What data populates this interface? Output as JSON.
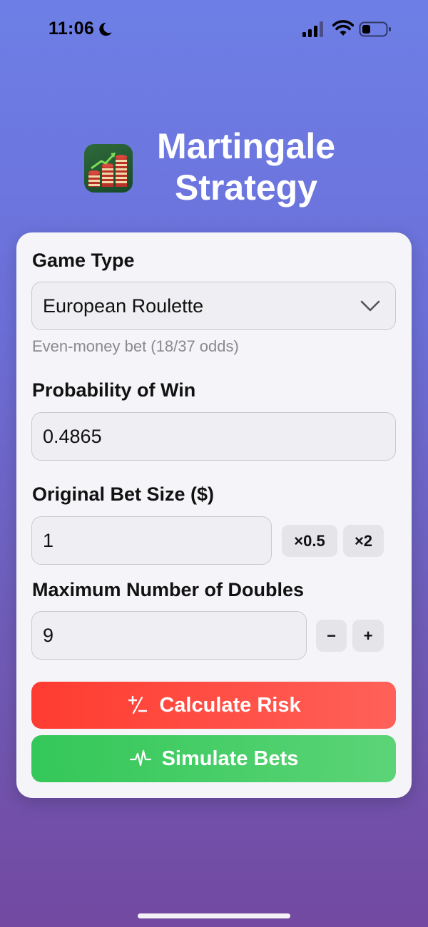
{
  "status_bar": {
    "time": "11:06"
  },
  "header": {
    "title": "Martingale Strategy"
  },
  "form": {
    "game_type": {
      "label": "Game Type",
      "selected": "European Roulette",
      "hint": "Even-money bet (18/37 odds)"
    },
    "probability": {
      "label": "Probability of Win",
      "value": "0.4865"
    },
    "bet_size": {
      "label": "Original Bet Size ($)",
      "value": "1",
      "half_label": "×0.5",
      "double_label": "×2"
    },
    "max_doubles": {
      "label": "Maximum Number of Doubles",
      "value": "9",
      "decrement_label": "−",
      "increment_label": "+"
    }
  },
  "actions": {
    "calculate_label": "Calculate Risk",
    "simulate_label": "Simulate Bets"
  },
  "colors": {
    "calculate": "#ff3b30",
    "simulate": "#34c759"
  }
}
